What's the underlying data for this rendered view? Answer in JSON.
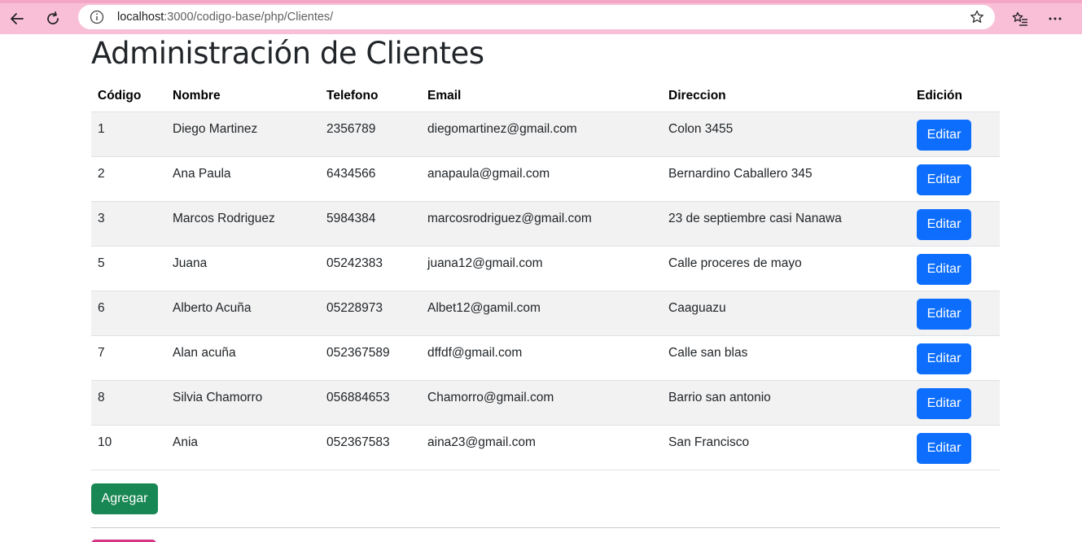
{
  "browser": {
    "url_host": "localhost",
    "url_rest": ":3000/codigo-base/php/Clientes/"
  },
  "page": {
    "title": "Administración de Clientes"
  },
  "table": {
    "headers": [
      "Código",
      "Nombre",
      "Telefono",
      "Email",
      "Direccion",
      "Edición"
    ],
    "rows": [
      {
        "codigo": "1",
        "nombre": "Diego Martinez",
        "telefono": "2356789",
        "email": "diegomartinez@gmail.com",
        "direccion": "Colon 3455",
        "action": "Editar"
      },
      {
        "codigo": "2",
        "nombre": "Ana Paula",
        "telefono": "6434566",
        "email": "anapaula@gmail.com",
        "direccion": "Bernardino Caballero 345",
        "action": "Editar"
      },
      {
        "codigo": "3",
        "nombre": "Marcos Rodriguez",
        "telefono": "5984384",
        "email": "marcosrodriguez@gmail.com",
        "direccion": "23 de septiembre casi Nanawa",
        "action": "Editar"
      },
      {
        "codigo": "5",
        "nombre": "Juana",
        "telefono": "05242383",
        "email": "juana12@gmail.com",
        "direccion": "Calle proceres de mayo",
        "action": "Editar"
      },
      {
        "codigo": "6",
        "nombre": "Alberto Acuña",
        "telefono": "05228973",
        "email": "Albet12@gamil.com",
        "direccion": "Caaguazu",
        "action": "Editar"
      },
      {
        "codigo": "7",
        "nombre": "Alan acuña",
        "telefono": "052367589",
        "email": "dffdf@gmail.com",
        "direccion": "Calle san blas",
        "action": "Editar"
      },
      {
        "codigo": "8",
        "nombre": "Silvia Chamorro",
        "telefono": "056884653",
        "email": "Chamorro@gmail.com",
        "direccion": "Barrio san antonio",
        "action": "Editar"
      },
      {
        "codigo": "10",
        "nombre": "Ania",
        "telefono": "052367583",
        "email": "aina23@gmail.com",
        "direccion": "San Francisco",
        "action": "Editar"
      }
    ]
  },
  "actions": {
    "add_label": "Agregar"
  },
  "colors": {
    "browser_bar": "#f8bfd6",
    "edit_button": "#0d6efd",
    "add_button": "#198754",
    "row_stripe": "#f2f2f2"
  },
  "icons": {
    "back": "back-arrow-icon",
    "reload": "reload-icon",
    "info": "info-icon",
    "favorite": "star-icon",
    "favorites_list": "favorites-icon",
    "more": "more-icon"
  }
}
